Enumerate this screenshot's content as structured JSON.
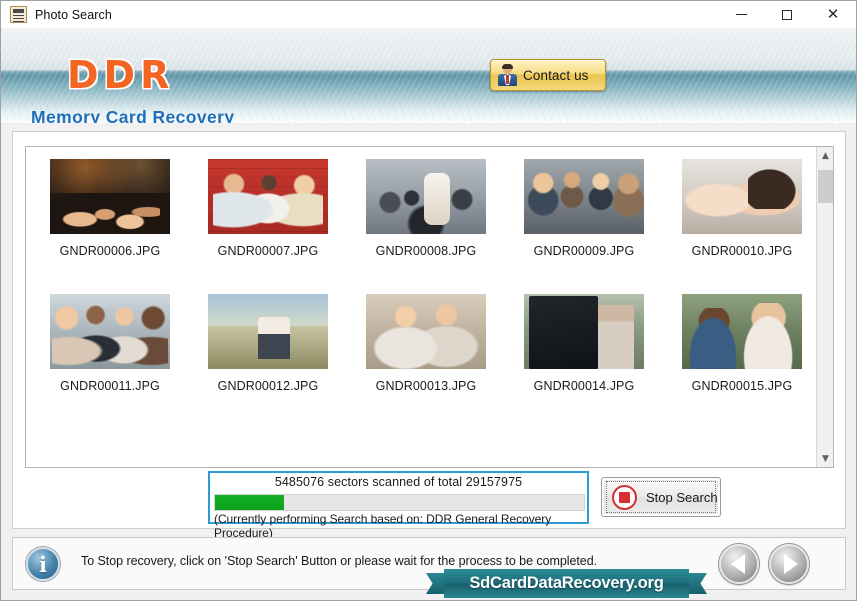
{
  "window": {
    "title": "Photo Search",
    "icon": "photo-document-icon",
    "buttons": {
      "minimize": "minimize-icon",
      "maximize": "maximize-icon",
      "close": "close-icon"
    }
  },
  "header": {
    "logo": "DDR",
    "subtitle": "Memory Card Recovery",
    "contact": {
      "label": "Contact us",
      "icon": "person-icon"
    },
    "logo_color": "#f26522",
    "subtitle_color": "#1f6fb8"
  },
  "thumbnails": {
    "rows": [
      [
        {
          "label": "GNDR00006.JPG",
          "art": "p6"
        },
        {
          "label": "GNDR00007.JPG",
          "art": "p7"
        },
        {
          "label": "GNDR00008.JPG",
          "art": "p8"
        },
        {
          "label": "GNDR00009.JPG",
          "art": "p9"
        },
        {
          "label": "GNDR00010.JPG",
          "art": "p10"
        }
      ],
      [
        {
          "label": "GNDR00011.JPG",
          "art": "p11"
        },
        {
          "label": "GNDR00012.JPG",
          "art": "p12"
        },
        {
          "label": "GNDR00013.JPG",
          "art": "p13"
        },
        {
          "label": "GNDR00014.JPG",
          "art": "p14"
        },
        {
          "label": "GNDR00015.JPG",
          "art": "p15"
        }
      ]
    ],
    "scrollbar": {
      "up": "chevron-up-icon",
      "down": "chevron-down-icon"
    }
  },
  "progress": {
    "caption": "5485076 sectors scanned of total 29157975",
    "note": "(Currently performing Search based on:  DDR General Recovery Procedure)",
    "sectors_scanned": 5485076,
    "sectors_total": 29157975,
    "percent": 18.8,
    "fill_color": "#0faf1e",
    "border_color": "#2e9bd6"
  },
  "stop_button": {
    "label": "Stop Search",
    "icon": "stop-square-icon"
  },
  "status": {
    "icon": "info-icon",
    "text": "To Stop recovery, click on 'Stop Search' Button or please wait for the process to be completed.",
    "ribbon": "SdCardDataRecovery.org",
    "ribbon_color": "#1f6f7d"
  },
  "navigation": {
    "previous": "arrow-left-icon",
    "next": "arrow-right-icon"
  }
}
